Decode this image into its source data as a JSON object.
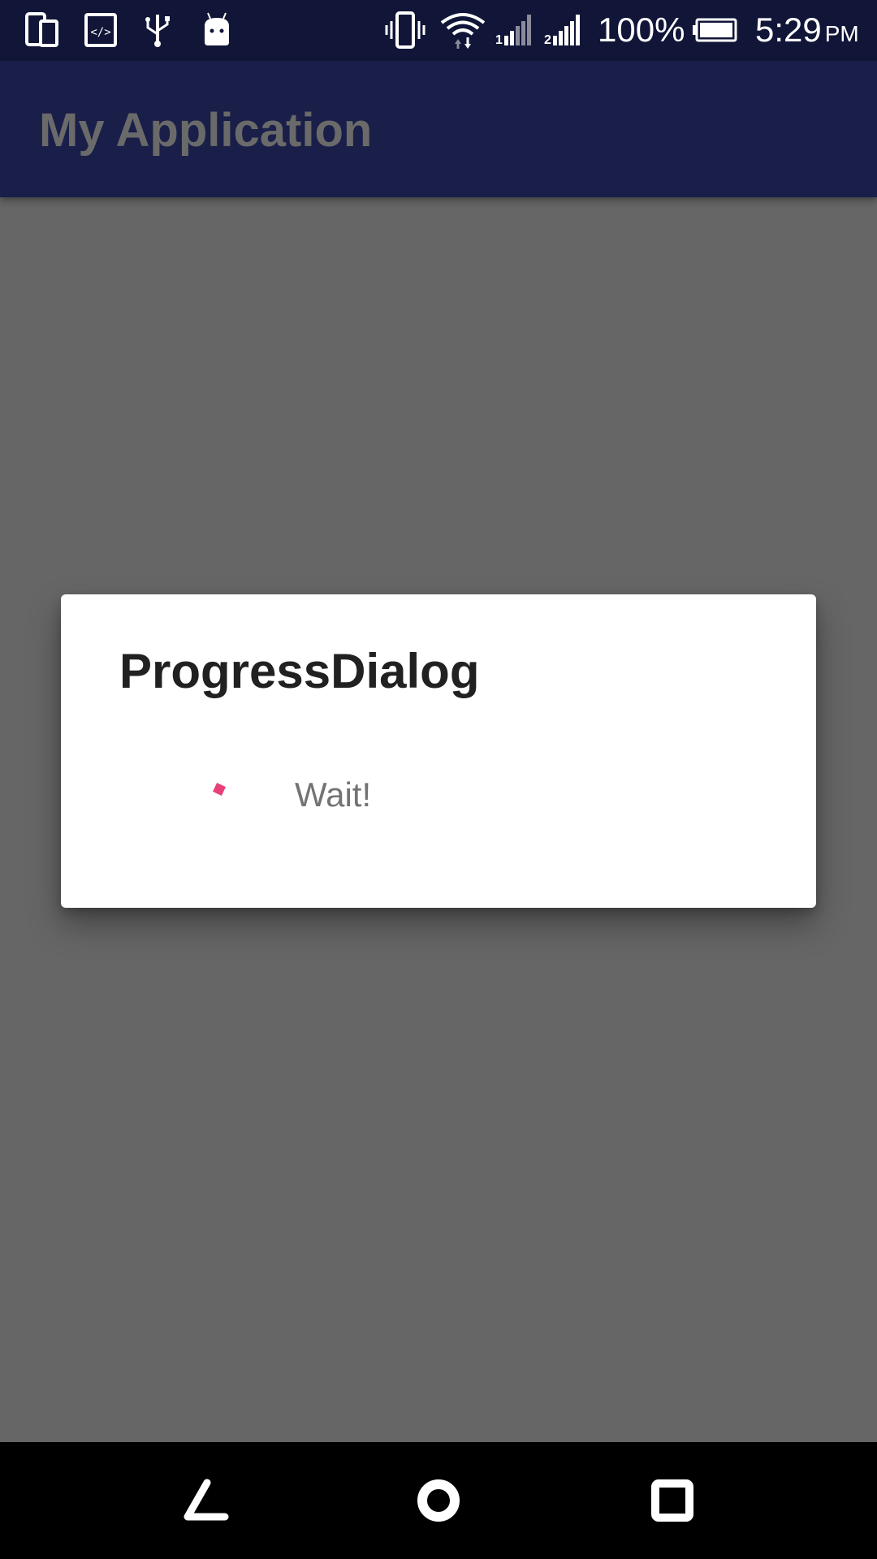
{
  "status_bar": {
    "battery_percent": "100%",
    "battery_level": 1.0,
    "time": "5:29",
    "ampm": "PM",
    "icons": [
      "device-icon",
      "code-icon",
      "usb-icon",
      "android-icon",
      "vibrate-icon",
      "wifi-icon",
      "signal-1-icon",
      "signal-2-icon",
      "battery-icon"
    ]
  },
  "app_bar": {
    "title": "My Application"
  },
  "dialog": {
    "title": "ProgressDialog",
    "message": "Wait!",
    "spinner_color": "#e8407a"
  },
  "nav_bar": {
    "icons": [
      "back-icon",
      "home-icon",
      "recents-icon"
    ]
  },
  "colors": {
    "status_bar": "#111638",
    "app_bar": "#191f49",
    "scrim": "#666666",
    "dialog": "#ffffff"
  }
}
